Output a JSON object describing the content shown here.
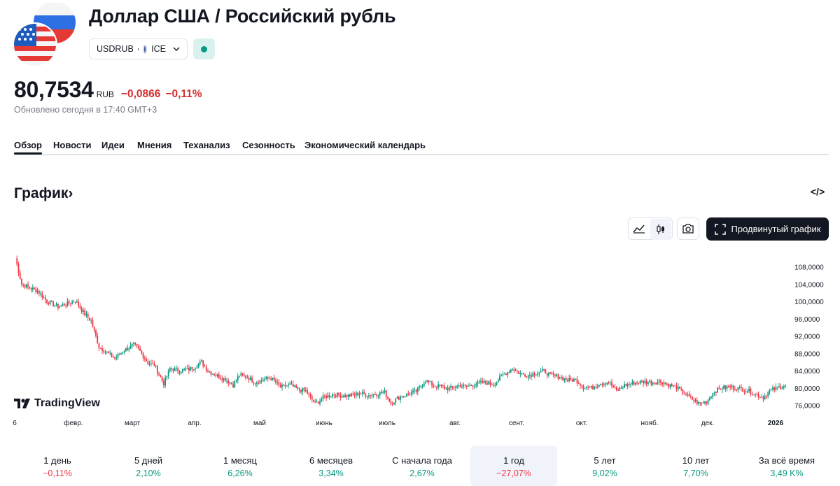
{
  "header": {
    "title": "Доллар США / Российский рубль",
    "symbol": "USDRUB",
    "exchange": "ICE",
    "market_status_color": "#089981"
  },
  "quote": {
    "price": "80,7534",
    "currency": "RUB",
    "change": "−0,0866",
    "change_percent": "−0,11%",
    "updated": "Обновлено сегодня в 17:40 GMT+3",
    "change_color": "#d32f2f"
  },
  "tabs": [
    "Обзор",
    "Новости",
    "Идеи",
    "Мнения",
    "Теханализ",
    "Сезонность",
    "Экономический календарь"
  ],
  "chart_section": {
    "title": "График",
    "title_arrow": "›",
    "embed_label": "</>",
    "advanced_button": "Продвинутый график",
    "icons": [
      "area-chart-icon",
      "candles-icon",
      "camera-icon",
      "fullscreen-icon"
    ]
  },
  "branding": {
    "logo_text": "TradingView"
  },
  "chart_data": {
    "type": "candlestick",
    "title": "",
    "xlabel": "",
    "ylabel": "",
    "ylim": [
      73.5,
      111
    ],
    "yticks": [
      "108,0000",
      "104,0000",
      "100,0000",
      "96,0000",
      "92,0000",
      "88,0000",
      "84,0000",
      "80,0000",
      "76,0000"
    ],
    "ytick_values": [
      108,
      104,
      100,
      96,
      92,
      88,
      84,
      80,
      76
    ],
    "xticks": [
      "6",
      "февр.",
      "март",
      "апр.",
      "май",
      "июнь",
      "июль",
      "авг.",
      "сент.",
      "окт.",
      "нояб.",
      "дек.",
      "2026"
    ],
    "close_path": [
      [
        0,
        110
      ],
      [
        4,
        104
      ],
      [
        10,
        103
      ],
      [
        14,
        102.5
      ],
      [
        20,
        100
      ],
      [
        27,
        98.8
      ],
      [
        33,
        99.5
      ],
      [
        38,
        100.2
      ],
      [
        43,
        97.5
      ],
      [
        48,
        95.5
      ],
      [
        53,
        89.5
      ],
      [
        57,
        88.5
      ],
      [
        63,
        86.8
      ],
      [
        69,
        88.8
      ],
      [
        75,
        90
      ],
      [
        79,
        88.5
      ],
      [
        84,
        85.8
      ],
      [
        88,
        85.3
      ],
      [
        94,
        81
      ],
      [
        98,
        84.5
      ],
      [
        104,
        84
      ],
      [
        110,
        84.3
      ],
      [
        114,
        85
      ],
      [
        118,
        86
      ],
      [
        122,
        84
      ],
      [
        127,
        83
      ],
      [
        133,
        82
      ],
      [
        138,
        80.7
      ],
      [
        142,
        83
      ],
      [
        147,
        82.5
      ],
      [
        152,
        81.3
      ],
      [
        158,
        82
      ],
      [
        162,
        82.3
      ],
      [
        168,
        80.2
      ],
      [
        174,
        80.7
      ],
      [
        178,
        79.8
      ],
      [
        184,
        79.3
      ],
      [
        190,
        76.3
      ],
      [
        196,
        78
      ],
      [
        202,
        78.5
      ],
      [
        208,
        78.2
      ],
      [
        214,
        78.3
      ],
      [
        218,
        78.8
      ],
      [
        224,
        78.3
      ],
      [
        229,
        78.7
      ],
      [
        234,
        79
      ],
      [
        238,
        76.5
      ],
      [
        243,
        77.8
      ],
      [
        249,
        78.6
      ],
      [
        254,
        79.2
      ],
      [
        260,
        81.8
      ],
      [
        265,
        80.5
      ],
      [
        270,
        80.3
      ],
      [
        275,
        79.8
      ],
      [
        281,
        80.6
      ],
      [
        286,
        80.3
      ],
      [
        292,
        81
      ],
      [
        298,
        81.3
      ],
      [
        303,
        80.8
      ],
      [
        309,
        83
      ],
      [
        315,
        84.5
      ],
      [
        320,
        83.3
      ],
      [
        325,
        82.9
      ],
      [
        330,
        83.5
      ],
      [
        335,
        83.9
      ],
      [
        340,
        82.8
      ],
      [
        345,
        82.6
      ],
      [
        350,
        81.8
      ],
      [
        355,
        81.9
      ],
      [
        360,
        80.4
      ],
      [
        365,
        80
      ],
      [
        370,
        81
      ],
      [
        376,
        81.4
      ],
      [
        381,
        79.3
      ],
      [
        386,
        80.6
      ],
      [
        392,
        81.2
      ],
      [
        398,
        81.4
      ],
      [
        404,
        81.3
      ],
      [
        409,
        81.5
      ],
      [
        414,
        80.7
      ],
      [
        419,
        80.1
      ],
      [
        424,
        78.7
      ],
      [
        428,
        77.6
      ],
      [
        433,
        76.4
      ],
      [
        438,
        76.8
      ],
      [
        443,
        79.3
      ],
      [
        448,
        80
      ],
      [
        453,
        80.3
      ],
      [
        459,
        79.8
      ],
      [
        464,
        79.5
      ],
      [
        469,
        78.6
      ],
      [
        474,
        77.8
      ],
      [
        478,
        79.3
      ],
      [
        483,
        80
      ],
      [
        488,
        80.7
      ]
    ]
  },
  "periods": [
    {
      "label": "1 день",
      "value": "−0,11%",
      "dir": "down"
    },
    {
      "label": "5 дней",
      "value": "2,10%",
      "dir": "up"
    },
    {
      "label": "1 месяц",
      "value": "6,26%",
      "dir": "up"
    },
    {
      "label": "6 месяцев",
      "value": "3,34%",
      "dir": "up"
    },
    {
      "label": "С начала года",
      "value": "2,67%",
      "dir": "up"
    },
    {
      "label": "1 год",
      "value": "−27,07%",
      "dir": "down",
      "selected": true
    },
    {
      "label": "5 лет",
      "value": "9,02%",
      "dir": "up"
    },
    {
      "label": "10 лет",
      "value": "7,70%",
      "dir": "up"
    },
    {
      "label": "За всё время",
      "value": "3,49 K%",
      "dir": "up"
    }
  ],
  "colors": {
    "up": "#089981",
    "down": "#f23645",
    "text": "#131722",
    "muted": "#787b86"
  }
}
